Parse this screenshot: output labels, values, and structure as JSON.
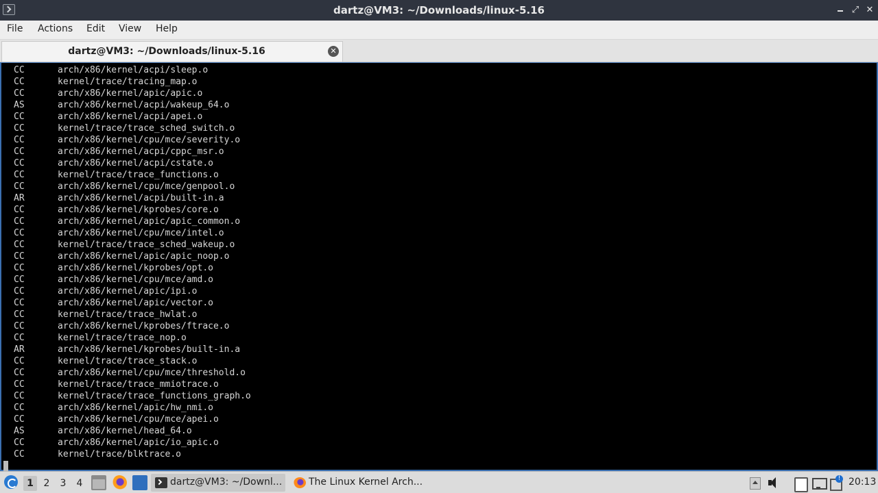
{
  "window": {
    "title": "dartz@VM3: ~/Downloads/linux-5.16"
  },
  "menu": [
    "File",
    "Actions",
    "Edit",
    "View",
    "Help"
  ],
  "tab": {
    "label": "dartz@VM3: ~/Downloads/linux-5.16"
  },
  "terminal": {
    "lines": [
      {
        "code": "CC",
        "path": "arch/x86/kernel/acpi/sleep.o"
      },
      {
        "code": "CC",
        "path": "kernel/trace/tracing_map.o"
      },
      {
        "code": "CC",
        "path": "arch/x86/kernel/apic/apic.o"
      },
      {
        "code": "AS",
        "path": "arch/x86/kernel/acpi/wakeup_64.o"
      },
      {
        "code": "CC",
        "path": "arch/x86/kernel/acpi/apei.o"
      },
      {
        "code": "CC",
        "path": "kernel/trace/trace_sched_switch.o"
      },
      {
        "code": "CC",
        "path": "arch/x86/kernel/cpu/mce/severity.o"
      },
      {
        "code": "CC",
        "path": "arch/x86/kernel/acpi/cppc_msr.o"
      },
      {
        "code": "CC",
        "path": "arch/x86/kernel/acpi/cstate.o"
      },
      {
        "code": "CC",
        "path": "kernel/trace/trace_functions.o"
      },
      {
        "code": "CC",
        "path": "arch/x86/kernel/cpu/mce/genpool.o"
      },
      {
        "code": "AR",
        "path": "arch/x86/kernel/acpi/built-in.a"
      },
      {
        "code": "CC",
        "path": "arch/x86/kernel/kprobes/core.o"
      },
      {
        "code": "CC",
        "path": "arch/x86/kernel/apic/apic_common.o"
      },
      {
        "code": "CC",
        "path": "arch/x86/kernel/cpu/mce/intel.o"
      },
      {
        "code": "CC",
        "path": "kernel/trace/trace_sched_wakeup.o"
      },
      {
        "code": "CC",
        "path": "arch/x86/kernel/apic/apic_noop.o"
      },
      {
        "code": "CC",
        "path": "arch/x86/kernel/kprobes/opt.o"
      },
      {
        "code": "CC",
        "path": "arch/x86/kernel/cpu/mce/amd.o"
      },
      {
        "code": "CC",
        "path": "arch/x86/kernel/apic/ipi.o"
      },
      {
        "code": "CC",
        "path": "arch/x86/kernel/apic/vector.o"
      },
      {
        "code": "CC",
        "path": "kernel/trace/trace_hwlat.o"
      },
      {
        "code": "CC",
        "path": "arch/x86/kernel/kprobes/ftrace.o"
      },
      {
        "code": "CC",
        "path": "kernel/trace/trace_nop.o"
      },
      {
        "code": "AR",
        "path": "arch/x86/kernel/kprobes/built-in.a"
      },
      {
        "code": "CC",
        "path": "kernel/trace/trace_stack.o"
      },
      {
        "code": "CC",
        "path": "arch/x86/kernel/cpu/mce/threshold.o"
      },
      {
        "code": "CC",
        "path": "kernel/trace/trace_mmiotrace.o"
      },
      {
        "code": "CC",
        "path": "kernel/trace/trace_functions_graph.o"
      },
      {
        "code": "CC",
        "path": "arch/x86/kernel/apic/hw_nmi.o"
      },
      {
        "code": "CC",
        "path": "arch/x86/kernel/cpu/mce/apei.o"
      },
      {
        "code": "AS",
        "path": "arch/x86/kernel/head_64.o"
      },
      {
        "code": "CC",
        "path": "arch/x86/kernel/apic/io_apic.o"
      },
      {
        "code": "CC",
        "path": "kernel/trace/blktrace.o"
      }
    ]
  },
  "taskbar": {
    "workspaces": [
      "1",
      "2",
      "3",
      "4"
    ],
    "active_workspace": "1",
    "tasks": [
      {
        "label": "dartz@VM3: ~/Downl...",
        "icon": "terminal-icon"
      },
      {
        "label": "The Linux Kernel Arch...",
        "icon": "firefox-icon"
      }
    ],
    "clock": "20:13"
  },
  "colors": {
    "titlebar": "#2f343f",
    "terminal_bg": "#000000",
    "terminal_fg": "#d7d7d7",
    "accent": "#3b6fb0"
  }
}
